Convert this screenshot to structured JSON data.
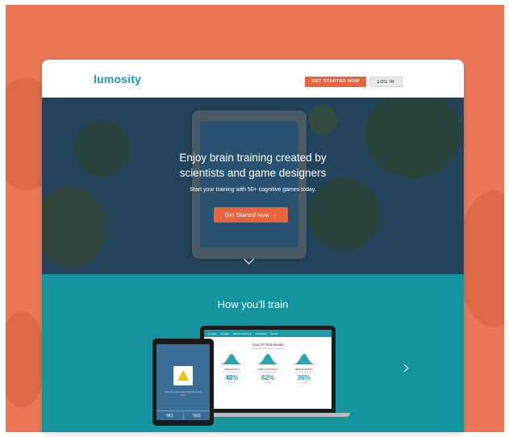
{
  "brand": {
    "logo": "lumosity",
    "accent": "#1b9aa8",
    "cta_color": "#e8643f",
    "background": "#ec7758"
  },
  "nav": {
    "get_started_label": "GET STARTED NOW",
    "login_label": "LOG IN"
  },
  "hero": {
    "title_line1": "Enjoy brain training created by",
    "title_line2": "scientists and game designers",
    "subtitle": "Start your training with 50+ cognitive games today.",
    "cta_label": "Get Started Now →"
  },
  "train": {
    "title": "How you'll train",
    "laptop": {
      "nav_logo": "lumosity",
      "nav_items": [
        "GAMES",
        "BRAIN PROFILE",
        "SCIENCE",
        "STATS"
      ],
      "heading": "Your Fit Test results",
      "subheading": "Compared to others in your age group",
      "results": [
        {
          "label": "SPEED MATCH",
          "note": "You scored higher than",
          "value": "48%",
          "tail": "of people"
        },
        {
          "label": "TRAIN OF THOUGHT",
          "note": "You scored higher than",
          "value": "62%",
          "tail": "of people"
        },
        {
          "label": "MEMORY MATRIX",
          "note": "You scored higher than",
          "value": "36%",
          "tail": "of people"
        }
      ]
    },
    "tablet": {
      "prompt": "Does the previous card match the current card?",
      "no_label": "NO",
      "yes_label": "YES"
    }
  }
}
